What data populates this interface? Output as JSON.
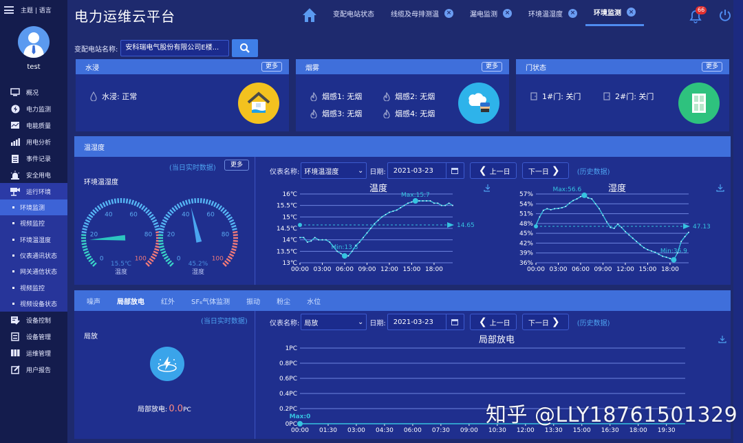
{
  "sidebar": {
    "theme_lang": "主题 | 语言",
    "username": "test",
    "menu": [
      {
        "label": "概况",
        "icon": "monitor-icon"
      },
      {
        "label": "电力监测",
        "icon": "lightning-icon"
      },
      {
        "label": "电能质量",
        "icon": "chart-doc-icon"
      },
      {
        "label": "用电分析",
        "icon": "bar-chart-icon"
      },
      {
        "label": "事件记录",
        "icon": "clipboard-icon"
      },
      {
        "label": "安全用电",
        "icon": "alarm-light-icon"
      },
      {
        "label": "运行环境",
        "icon": "camera-network-icon"
      }
    ],
    "submenu": [
      {
        "label": "环境监测",
        "active": true
      },
      {
        "label": "视频监控"
      },
      {
        "label": "环境温湿度"
      },
      {
        "label": "仪表通讯状态"
      },
      {
        "label": "网关通信状态"
      },
      {
        "label": "视频监控"
      },
      {
        "label": "视频设备状态"
      }
    ],
    "menu_bottom": [
      {
        "label": "设备控制",
        "icon": "device-control-icon"
      },
      {
        "label": "设备管理",
        "icon": "device-manage-icon"
      },
      {
        "label": "运维管理",
        "icon": "grid-icon"
      },
      {
        "label": "用户报告",
        "icon": "edit-icon"
      }
    ]
  },
  "header": {
    "title": "电力运维云平台",
    "tabs": [
      {
        "label": "变配电站状态",
        "closable": false
      },
      {
        "label": "线缆及母排测温",
        "closable": true
      },
      {
        "label": "漏电监测",
        "closable": true
      },
      {
        "label": "环境温湿度",
        "closable": true
      },
      {
        "label": "环境监测",
        "closable": true,
        "active": true
      }
    ],
    "notification_count": "66"
  },
  "search": {
    "label": "变配电站名称:",
    "value": "安科瑞电气股份有限公司E楼..."
  },
  "cards": {
    "water": {
      "title": "水浸",
      "more": "更多",
      "items": [
        "水浸: 正常"
      ]
    },
    "smoke": {
      "title": "烟雾",
      "more": "更多",
      "items": [
        "烟感1: 无烟",
        "烟感2: 无烟",
        "烟感3: 无烟",
        "烟感4: 无烟"
      ]
    },
    "door": {
      "title": "门状态",
      "more": "更多",
      "items": [
        "1#门: 关门",
        "2#门: 关门"
      ]
    }
  },
  "temp_humidity": {
    "section_title": "温湿度",
    "realtime": "(当日实时数据)",
    "more": "更多",
    "label": "环境温湿度",
    "gauges": [
      {
        "name": "温度",
        "value": 15.5,
        "display": "15.5℃",
        "min": 0,
        "max": 100,
        "ticks": [
          "0",
          "20",
          "40",
          "60",
          "80",
          "100"
        ]
      },
      {
        "name": "湿度",
        "value": 45.2,
        "display": "45.2%",
        "min": 0,
        "max": 100,
        "ticks": [
          "0",
          "20",
          "40",
          "60",
          "80",
          "100"
        ]
      }
    ],
    "controls": {
      "meter_label": "仪表名称:",
      "meter_value": "环境温湿度",
      "date_label": "日期:",
      "date_value": "2021-03-23",
      "prev": "上一日",
      "next": "下一日",
      "history": "(历史数据)"
    }
  },
  "partial_discharge": {
    "tabs": [
      "噪声",
      "局部放电",
      "红外",
      "SF₆气体监测",
      "振动",
      "粉尘",
      "水位"
    ],
    "active_tab": 1,
    "realtime": "(当日实时数据)",
    "label": "局放",
    "value_label": "局部放电:",
    "value": "0.0",
    "unit": "PC",
    "controls": {
      "meter_label": "仪表名称:",
      "meter_value": "局放",
      "date_label": "日期:",
      "date_value": "2021-03-23",
      "prev": "上一日",
      "next": "下一日",
      "history": "(历史数据)"
    }
  },
  "chart_data": [
    {
      "type": "line",
      "title": "温度",
      "ylim": [
        13,
        16
      ],
      "yticks": [
        "13℃",
        "13.5℃",
        "14℃",
        "14.5℃",
        "15℃",
        "15.5℃",
        "16℃"
      ],
      "xticks": [
        "00:00",
        "03:00",
        "06:00",
        "09:00",
        "12:00",
        "15:00",
        "18:00"
      ],
      "x_hours": [
        0,
        0.5,
        1,
        1.5,
        2,
        2.5,
        3,
        3.5,
        4,
        4.5,
        5,
        5.5,
        6,
        6.5,
        7,
        7.5,
        8,
        8.5,
        9,
        9.5,
        10,
        10.5,
        11,
        11.5,
        12,
        12.5,
        13,
        13.5,
        14,
        14.5,
        15,
        15.5,
        16,
        16.5,
        17,
        17.5,
        18,
        18.5,
        19,
        19.5,
        20,
        20.5
      ],
      "values": [
        14.1,
        14.1,
        13.9,
        13.95,
        14.1,
        14.0,
        14.0,
        14.0,
        13.9,
        13.7,
        13.5,
        13.4,
        13.3,
        13.3,
        13.5,
        13.75,
        13.9,
        14.1,
        14.3,
        14.5,
        14.7,
        14.85,
        15.0,
        15.1,
        15.2,
        15.25,
        15.3,
        15.4,
        15.5,
        15.6,
        15.65,
        15.7,
        15.7,
        15.7,
        15.7,
        15.7,
        15.6,
        15.6,
        15.5,
        15.5,
        15.6,
        15.5
      ],
      "max": {
        "label": "Max:15.7",
        "value": 15.7
      },
      "min": {
        "label": "Min:13.3",
        "value": 13.3
      },
      "average": {
        "label": "14.65",
        "value": 14.65
      }
    },
    {
      "type": "line",
      "title": "湿度",
      "ylim": [
        36,
        57
      ],
      "yticks": [
        "36%",
        "39%",
        "42%",
        "45%",
        "48%",
        "51%",
        "54%",
        "57%"
      ],
      "xticks": [
        "00:00",
        "03:00",
        "06:00",
        "09:00",
        "12:00",
        "15:00",
        "18:00"
      ],
      "x_hours": [
        0,
        0.5,
        1,
        1.5,
        2,
        2.5,
        3,
        3.5,
        4,
        4.5,
        5,
        5.5,
        6,
        6.5,
        7,
        7.5,
        8,
        8.5,
        9,
        9.5,
        10,
        10.5,
        11,
        11.5,
        12,
        12.5,
        13,
        13.5,
        14,
        14.5,
        15,
        15.5,
        16,
        16.5,
        17,
        17.5,
        18,
        18.5,
        19,
        19.5,
        20,
        20.5
      ],
      "values": [
        47.5,
        50,
        52,
        52.5,
        52.2,
        52.5,
        52.6,
        52.8,
        53.2,
        54.2,
        55,
        55.5,
        56.2,
        56.6,
        55.8,
        55.5,
        54,
        52.5,
        50.5,
        48.5,
        46.8,
        46.5,
        47.8,
        46.8,
        45.5,
        44.5,
        43.5,
        42.5,
        41.5,
        40.6,
        40,
        39.6,
        39.2,
        38.6,
        38,
        37.7,
        37.3,
        36.9,
        39,
        42.5,
        44,
        45.3
      ],
      "max": {
        "label": "Max:56.6",
        "value": 56.6
      },
      "min": {
        "label": "Min:36.9",
        "value": 36.9
      },
      "average": {
        "label": "47.13",
        "value": 47.13
      }
    },
    {
      "type": "line",
      "title": "局部放电",
      "ylim": [
        0,
        1
      ],
      "yticks": [
        "0PC",
        "0.2PC",
        "0.4PC",
        "0.6PC",
        "0.8PC",
        "1PC"
      ],
      "xticks": [
        "00:00",
        "01:30",
        "03:00",
        "04:30",
        "06:00",
        "07:30",
        "09:00",
        "10:30",
        "12:00",
        "13:30",
        "15:00",
        "16:30",
        "18:00",
        "19:30"
      ],
      "x_hours": [
        0,
        1.5,
        3,
        4.5,
        6,
        7.5,
        9,
        10.5,
        12,
        13.5,
        15,
        16.5,
        18,
        19.5,
        20.5
      ],
      "values": [
        0,
        0,
        0,
        0,
        0,
        0,
        0,
        0,
        0,
        0,
        0,
        0,
        0,
        0,
        0
      ],
      "max": {
        "label": "Max:0",
        "value": 0
      }
    }
  ],
  "watermark": "知乎 @LLY18761501329"
}
